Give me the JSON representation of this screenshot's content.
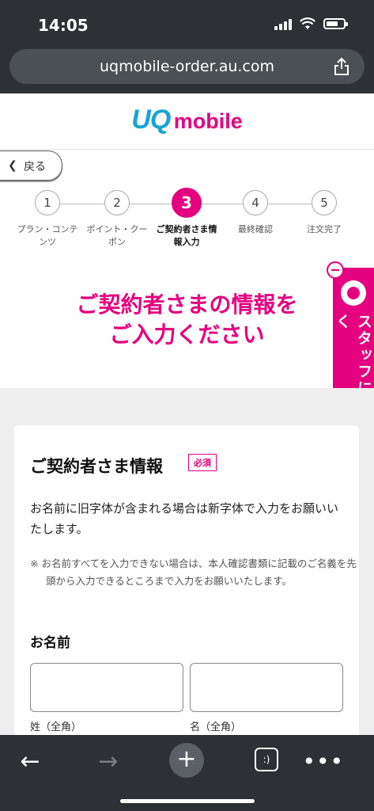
{
  "status": {
    "time": "14:05"
  },
  "browser": {
    "url": "uqmobile-order.au.com"
  },
  "brand": {
    "logo_uq": "UQ",
    "logo_mobile": "mobile"
  },
  "nav": {
    "back_label": "戻る"
  },
  "steps": [
    {
      "num": "1",
      "label": "プラン・コンテンツ",
      "active": false
    },
    {
      "num": "2",
      "label": "ポイント・クーポン",
      "active": false
    },
    {
      "num": "3",
      "label": "ご契約者さま情報入力",
      "active": true
    },
    {
      "num": "4",
      "label": "最終確認",
      "active": false
    },
    {
      "num": "5",
      "label": "注文完了",
      "active": false
    }
  ],
  "page": {
    "title_line1": "ご契約者さまの情報を",
    "title_line2": "ご入力ください"
  },
  "staff": {
    "label": "スタッフに聞く"
  },
  "section": {
    "title": "ご契約者さま情報",
    "required_badge": "必須",
    "description": "お名前に旧字体が含まれる場合は新字体で入力をお願いいたします。",
    "note": "※ お名前すべてを入力できない場合は、本人確認書類に記載のご名義を先頭から入力できるところまで入力をお願いいたします。",
    "name_label": "お名前",
    "last_name_caption": "姓（全角）",
    "first_name_caption": "名（全角）",
    "last_name_value": "",
    "first_name_value": ""
  },
  "toolbar": {
    "back": "←",
    "forward": "→",
    "new_tab": "+",
    "tabs": ":)",
    "more": "•••"
  },
  "colors": {
    "accent": "#e4007f",
    "brand_blue": "#1aa3d6",
    "chrome": "#2d3135"
  }
}
